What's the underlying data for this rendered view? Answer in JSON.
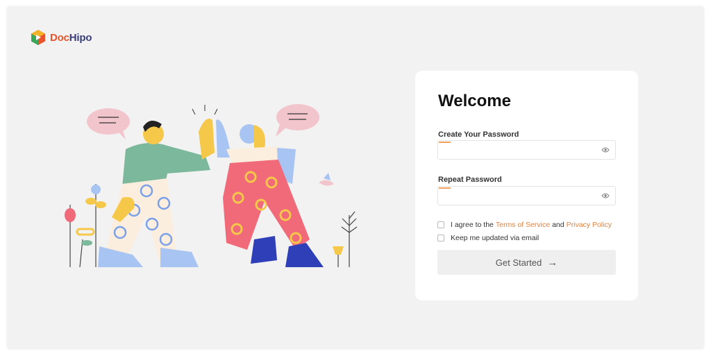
{
  "brand": {
    "name_part1": "Doc",
    "name_part2": "Hipo"
  },
  "form": {
    "title": "Welcome",
    "password_label": "Create Your Password",
    "password_placeholder": "",
    "repeat_label": "Repeat Password",
    "repeat_placeholder": "",
    "terms_prefix": "I agree to the",
    "terms_link": "Terms of Service",
    "terms_and": "and",
    "privacy_link": "Privacy Policy",
    "updates_label": "Keep me updated via email",
    "submit_label": "Get Started",
    "submit_arrow": "→"
  },
  "colors": {
    "accent_link": "#e0823e",
    "logo_orange": "#e8542b",
    "logo_green": "#3aa65a",
    "logo_navy": "#3a3f7a"
  },
  "icons": [
    "dochipo-logo-icon",
    "eye-icon",
    "arrow-right-icon"
  ]
}
